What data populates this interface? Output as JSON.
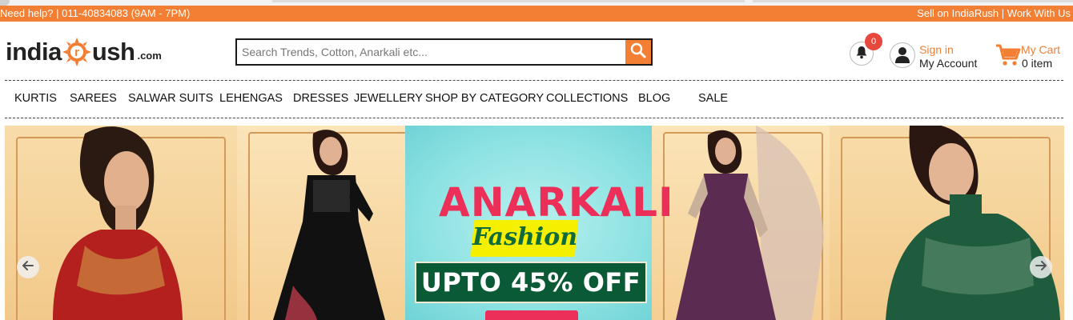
{
  "topbar": {
    "help_text": "Need help? | 011-40834083 (9AM - 7PM)",
    "sell_link": "Sell on IndiaRush",
    "separator": " | ",
    "work_link": "Work With Us"
  },
  "logo": {
    "left_word": "india",
    "right_word": "ush",
    "suffix": ".com",
    "center_letter": "r"
  },
  "search": {
    "placeholder": "Search Trends, Cotton, Anarkali etc...",
    "value": "",
    "button_icon": "search-icon"
  },
  "notifications": {
    "count": "0",
    "icon": "bell-icon"
  },
  "account": {
    "sign_in": "Sign in",
    "my_account": "My Account",
    "icon": "user-icon"
  },
  "cart": {
    "label": "My Cart",
    "count_text": "0 item",
    "icon": "cart-icon"
  },
  "nav": {
    "items": [
      {
        "label": "KURTIS"
      },
      {
        "label": "SAREES"
      },
      {
        "label": "SALWAR SUITS"
      },
      {
        "label": "LEHENGAS"
      },
      {
        "label": "DRESSES"
      },
      {
        "label": "JEWELLERY"
      },
      {
        "label": "SHOP BY CATEGORY"
      },
      {
        "label": "COLLECTIONS"
      },
      {
        "label": "BLOG"
      },
      {
        "label": "SALE"
      }
    ]
  },
  "banner": {
    "title": "ANARKALI",
    "subtitle": "Fashion",
    "offer": "UPTO 45% OFF",
    "prev_icon": "arrow-left-icon",
    "next_icon": "arrow-right-icon"
  },
  "colors": {
    "brand_orange": "#f27f33",
    "promo_pink": "#ec2f59",
    "promo_green": "#0b5a36",
    "promo_yellow": "#f4f000"
  }
}
